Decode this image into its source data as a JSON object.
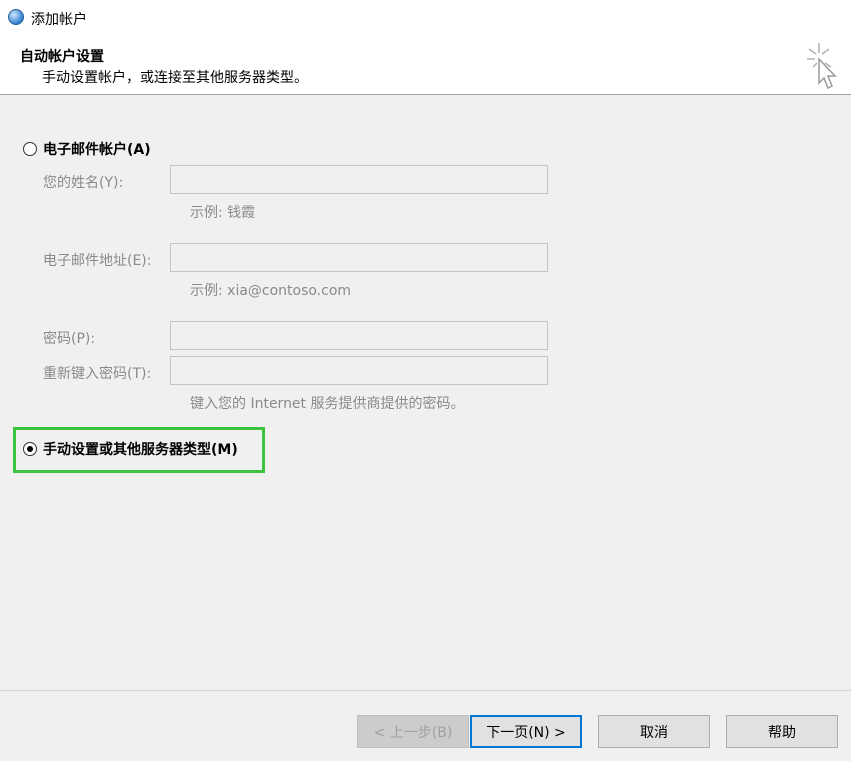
{
  "window": {
    "title": "添加帐户"
  },
  "header": {
    "title": "自动帐户设置",
    "subtitle": "手动设置帐户，或连接至其他服务器类型。"
  },
  "option_email": {
    "label": "电子邮件帐户(A)",
    "name_label": "您的姓名(Y):",
    "name_value": "",
    "name_hint": "示例: 钱霞",
    "email_label": "电子邮件地址(E):",
    "email_value": "",
    "email_hint": "示例: xia@contoso.com",
    "password_label": "密码(P):",
    "password_value": "",
    "retype_label": "重新键入密码(T):",
    "retype_value": "",
    "password_hint": "键入您的 Internet 服务提供商提供的密码。"
  },
  "option_manual": {
    "label": "手动设置或其他服务器类型(M)",
    "selected": true
  },
  "buttons": {
    "back": "< 上一步(B)",
    "next": "下一页(N) >",
    "cancel": "取消",
    "help": "帮助"
  },
  "colors": {
    "highlight": "#3cc43c",
    "primary_border": "#0078d7"
  }
}
